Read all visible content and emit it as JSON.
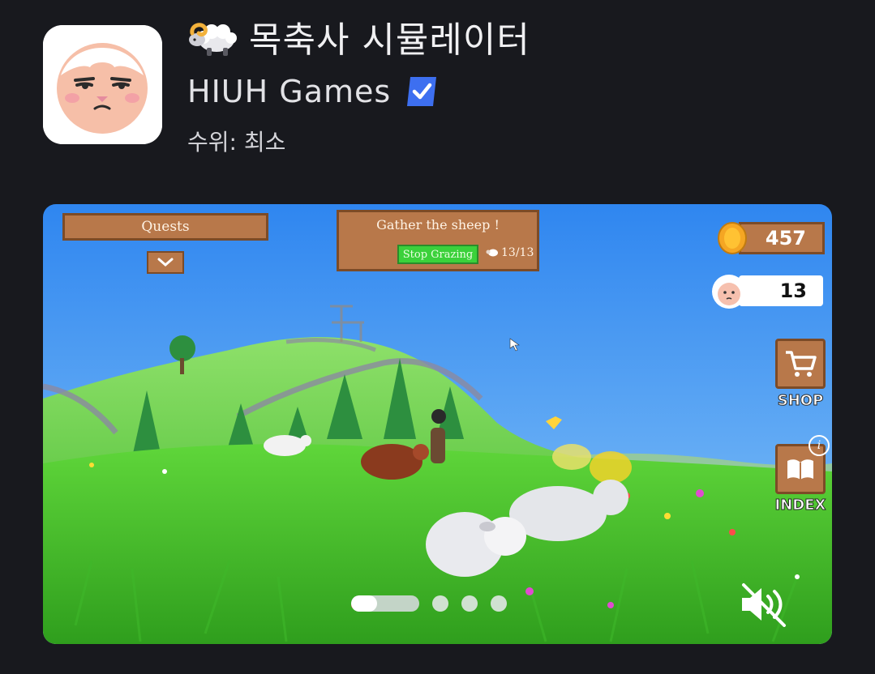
{
  "app": {
    "title": "목축사 시뮬레이터",
    "title_emoji": "ram-emoji",
    "developer": "HIUH Games",
    "verified_icon": "verified-badge-icon",
    "rating_label": "수위: 최소"
  },
  "media": {
    "hud": {
      "quests_label": "Quests",
      "quest_title": "Gather the sheep !",
      "quest_button_label": "Stop Grazing",
      "quest_progress": "13/13",
      "coins": "457",
      "sheep_count": "13",
      "shop_label": "SHOP",
      "index_label": "INDEX",
      "info_badge": "i"
    },
    "carousel": {
      "total_slides": 4,
      "active_slide": 1,
      "active_progress": 0.38
    },
    "mute_icon": "speaker-muted-icon"
  },
  "colors": {
    "background": "#18191e",
    "panel_brown": "#b8784a",
    "panel_border": "#7c4b27",
    "verified_blue": "#3d6ff0",
    "quest_button_green": "#3bd13b",
    "coin_gold": "#f5a623"
  }
}
